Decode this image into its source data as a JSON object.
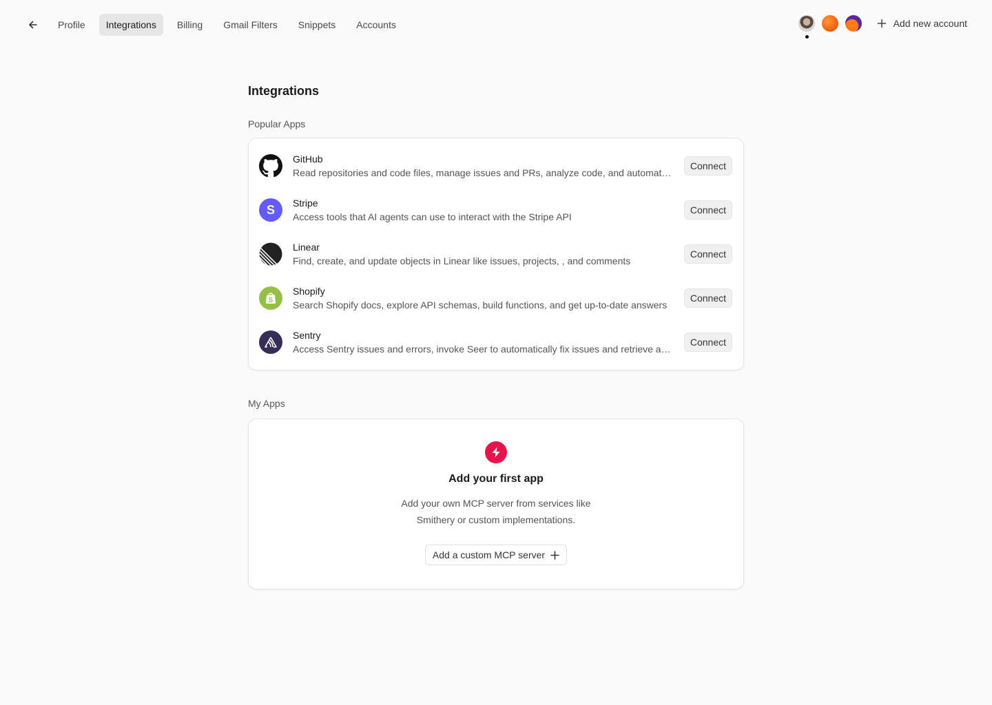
{
  "nav": {
    "tabs": [
      {
        "label": "Profile",
        "active": false
      },
      {
        "label": "Integrations",
        "active": true
      },
      {
        "label": "Billing",
        "active": false
      },
      {
        "label": "Gmail Filters",
        "active": false
      },
      {
        "label": "Snippets",
        "active": false
      },
      {
        "label": "Accounts",
        "active": false
      }
    ],
    "add_account_label": "Add new account"
  },
  "page": {
    "title": "Integrations",
    "popular_label": "Popular Apps",
    "my_apps_label": "My Apps"
  },
  "popular_apps": [
    {
      "name": "GitHub",
      "description": "Read repositories and code files, manage issues and PRs, analyze code, and automate workflows",
      "button": "Connect",
      "icon": "github-icon",
      "color": "#1a1a1a"
    },
    {
      "name": "Stripe",
      "description": "Access tools that AI agents can use to interact with the Stripe API",
      "button": "Connect",
      "icon": "stripe-icon",
      "color": "#635bff"
    },
    {
      "name": "Linear",
      "description": "Find, create, and update objects in Linear like issues, projects, , and comments",
      "button": "Connect",
      "icon": "linear-icon",
      "color": "#222222"
    },
    {
      "name": "Shopify",
      "description": "Search Shopify docs, explore API schemas, build functions, and get up-to-date answers",
      "button": "Connect",
      "icon": "shopify-icon",
      "color": "#95bf47"
    },
    {
      "name": "Sentry",
      "description": "Access Sentry issues and errors, invoke Seer to automatically fix issues and retrieve analysis",
      "button": "Connect",
      "icon": "sentry-icon",
      "color": "#362d59"
    }
  ],
  "empty_state": {
    "title": "Add your first app",
    "description": "Add your own MCP server from services like Smithery or custom implementations.",
    "button": "Add a custom MCP server",
    "accent": "#e8134a"
  }
}
